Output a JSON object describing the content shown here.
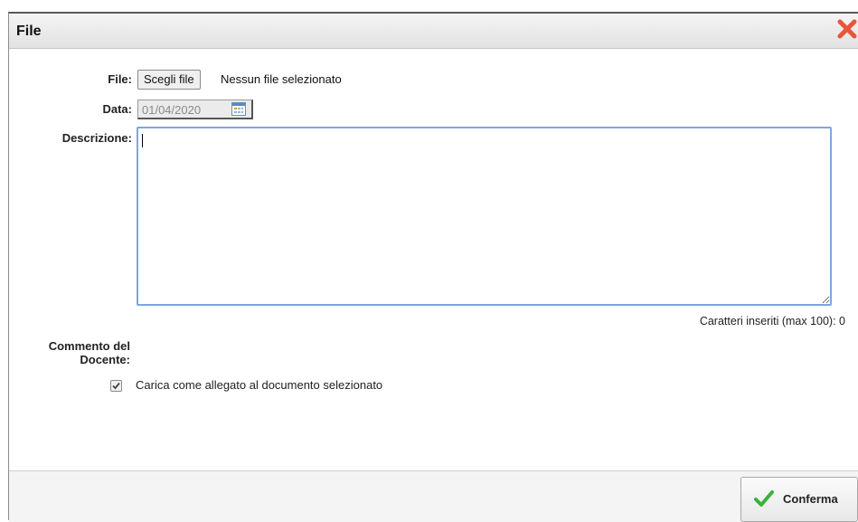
{
  "dialog": {
    "title": "File",
    "close_icon": "close-x-icon"
  },
  "form": {
    "file_label": "File:",
    "choose_file_button": "Scegli file",
    "no_file_text": "Nessun file selezionato",
    "date_label": "Data:",
    "date_value": "01/04/2020",
    "calendar_icon": "calendar-icon",
    "description_label": "Descrizione:",
    "description_value": "",
    "counter_text": "Caratteri inseriti (max 100): 0",
    "comment_label": "Commento del Docente:",
    "attach_checked": true,
    "attach_label": "Carica come allegato al documento selezionato"
  },
  "footer": {
    "confirm_label": "Conferma",
    "confirm_icon": "checkmark-icon"
  },
  "colors": {
    "close": "#e8553a",
    "check": "#3bb23b",
    "focus_border": "#7ba7e0"
  }
}
